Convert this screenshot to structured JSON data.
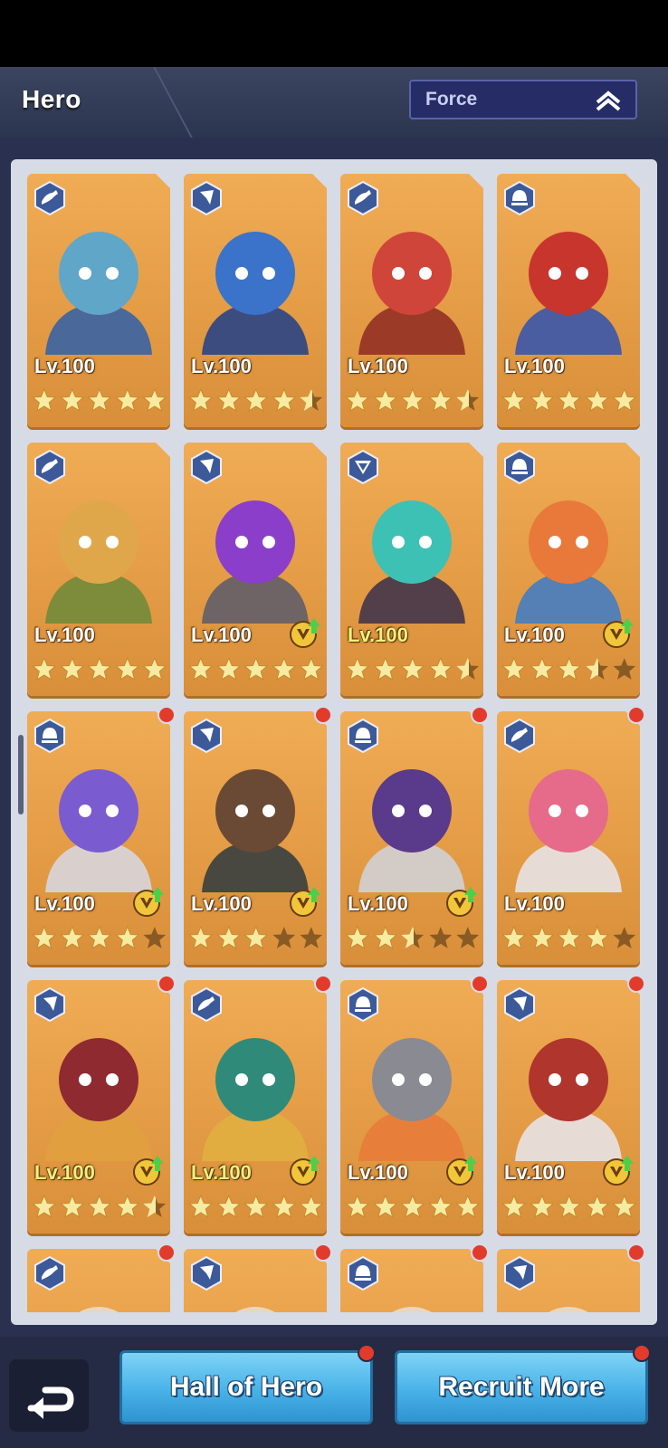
{
  "header": {
    "title": "Hero",
    "filter_label": "Force"
  },
  "colors": {
    "card_bg": "#e8a04a",
    "star_filled": "#f7eba2",
    "star_empty": "#8a5a24",
    "badge": "#3c5a9a",
    "button": "#48b2e8",
    "notification": "#e33b2b"
  },
  "heroes": [
    {
      "level": "Lv.100",
      "level_color": "white",
      "class_icon": "hand-class-icon",
      "stars": 5,
      "half": false,
      "upgrade": false,
      "dot": false,
      "portrait": "moth-robot-portrait"
    },
    {
      "level": "Lv.100",
      "level_color": "white",
      "class_icon": "arrow-class-icon",
      "stars": 4,
      "half": true,
      "upgrade": false,
      "dot": false,
      "portrait": "blue-bird-robot-portrait"
    },
    {
      "level": "Lv.100",
      "level_color": "white",
      "class_icon": "hand-class-icon",
      "stars": 4,
      "half": true,
      "upgrade": false,
      "dot": false,
      "portrait": "red-round-robot-portrait"
    },
    {
      "level": "Lv.100",
      "level_color": "white",
      "class_icon": "helmet-class-icon",
      "stars": 5,
      "half": false,
      "upgrade": false,
      "dot": false,
      "portrait": "red-skull-robot-portrait"
    },
    {
      "level": "Lv.100",
      "level_color": "white",
      "class_icon": "hand-class-icon",
      "stars": 5,
      "half": false,
      "upgrade": false,
      "dot": false,
      "portrait": "orange-hair-girl-portrait"
    },
    {
      "level": "Lv.100",
      "level_color": "white",
      "class_icon": "arrow-class-icon",
      "stars": 5,
      "half": false,
      "upgrade": true,
      "dot": false,
      "portrait": "purple-tank-portrait"
    },
    {
      "level": "Lv.100",
      "level_color": "gold",
      "class_icon": "triangle-class-icon",
      "stars": 4,
      "half": true,
      "upgrade": false,
      "dot": false,
      "portrait": "teal-hair-woman-portrait"
    },
    {
      "level": "Lv.100",
      "level_color": "white",
      "class_icon": "helmet-class-icon",
      "stars": 3,
      "half": true,
      "upgrade": true,
      "dot": false,
      "portrait": "orange-mech-portrait"
    },
    {
      "level": "Lv.100",
      "level_color": "white",
      "class_icon": "helmet-class-icon",
      "stars": 4,
      "half": false,
      "upgrade": true,
      "dot": true,
      "portrait": "purple-bat-robot-portrait"
    },
    {
      "level": "Lv.100",
      "level_color": "white",
      "class_icon": "arrow-class-icon",
      "stars": 3,
      "half": false,
      "upgrade": true,
      "dot": true,
      "portrait": "cowboy-robot-portrait"
    },
    {
      "level": "Lv.100",
      "level_color": "white",
      "class_icon": "helmet-class-icon",
      "stars": 2,
      "half": true,
      "upgrade": true,
      "dot": true,
      "portrait": "samurai-robot-portrait"
    },
    {
      "level": "Lv.100",
      "level_color": "white",
      "class_icon": "hand-class-icon",
      "stars": 4,
      "half": false,
      "upgrade": false,
      "dot": true,
      "portrait": "pink-bear-robot-portrait"
    },
    {
      "level": "Lv.100",
      "level_color": "gold",
      "class_icon": "arrow-class-icon",
      "stars": 4,
      "half": true,
      "upgrade": true,
      "dot": true,
      "portrait": "hooded-skull-portrait"
    },
    {
      "level": "Lv.100",
      "level_color": "gold",
      "class_icon": "hand-class-icon",
      "stars": 5,
      "half": false,
      "upgrade": true,
      "dot": true,
      "portrait": "green-helmet-robot-portrait"
    },
    {
      "level": "Lv.100",
      "level_color": "white",
      "class_icon": "helmet-class-icon",
      "stars": 5,
      "half": false,
      "upgrade": true,
      "dot": true,
      "portrait": "gray-knight-portrait"
    },
    {
      "level": "Lv.100",
      "level_color": "white",
      "class_icon": "arrow-class-icon",
      "stars": 5,
      "half": false,
      "upgrade": true,
      "dot": true,
      "portrait": "red-demon-robot-portrait"
    },
    {
      "level": "",
      "level_color": "white",
      "class_icon": "hand-class-icon",
      "stars": 0,
      "half": false,
      "upgrade": false,
      "dot": true,
      "portrait": "partial-portrait"
    },
    {
      "level": "",
      "level_color": "white",
      "class_icon": "arrow-class-icon",
      "stars": 0,
      "half": false,
      "upgrade": false,
      "dot": true,
      "portrait": "partial-portrait"
    },
    {
      "level": "",
      "level_color": "white",
      "class_icon": "helmet-class-icon",
      "stars": 0,
      "half": false,
      "upgrade": false,
      "dot": true,
      "portrait": "partial-portrait"
    },
    {
      "level": "",
      "level_color": "white",
      "class_icon": "arrow-class-icon",
      "stars": 0,
      "half": false,
      "upgrade": false,
      "dot": true,
      "portrait": "partial-portrait"
    }
  ],
  "footer": {
    "hall_label": "Hall of Hero",
    "recruit_label": "Recruit More"
  }
}
